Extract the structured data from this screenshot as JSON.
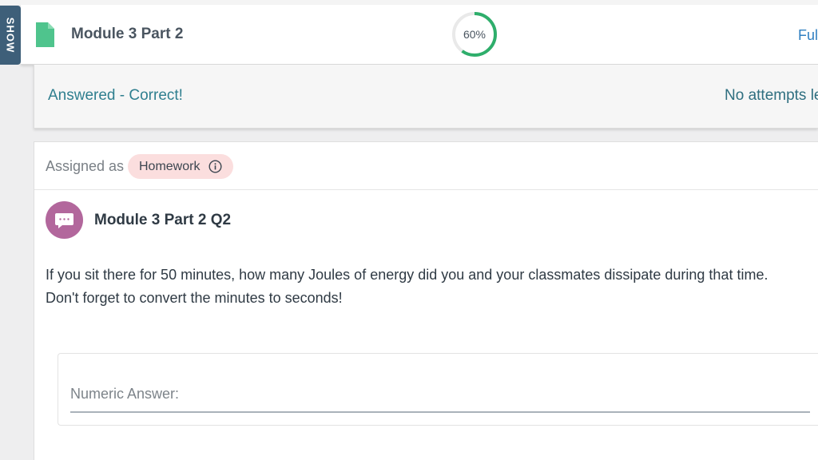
{
  "sidebar_tab": {
    "label": "SHOW"
  },
  "header": {
    "module_title": "Module 3 Part 2",
    "progress_percent": 60,
    "progress_label": "60%",
    "full_link_label": "Ful"
  },
  "status": {
    "answered_label": "Answered - Correct!",
    "attempts_label": "No attempts le"
  },
  "question": {
    "assigned_prefix": "Assigned as",
    "badge_label": "Homework",
    "title": "Module 3 Part 2 Q2",
    "text_line1": "If you sit there for 50 minutes, how many Joules of energy did you and your classmates dissipate during that time.",
    "text_line2": "Don't forget to convert the minutes to seconds!",
    "answer_placeholder": "Numeric Answer:",
    "answer_value": ""
  },
  "icons": {
    "doc": "file-icon",
    "info": "info-icon",
    "avatar": "chat-bubble-icon"
  },
  "colors": {
    "doc_icon": "#4fc48d",
    "progress": "#2eae6b",
    "progress_track": "#e9e9e9",
    "link": "#2f7fc1",
    "status_text": "#2f7f8f",
    "badge_bg": "#fbdede",
    "avatar_bg": "#b2679c",
    "show_tab_bg": "#3e5f79"
  }
}
